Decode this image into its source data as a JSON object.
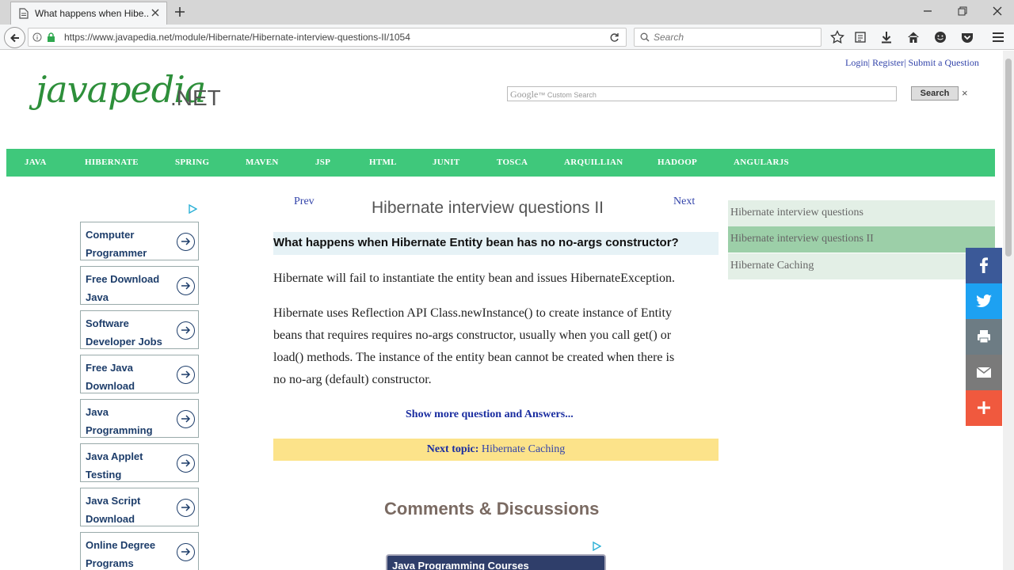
{
  "browser": {
    "tab_title": "What happens when Hibe...",
    "url": "https://www.javapedia.net/module/Hibernate/Hibernate-interview-questions-II/1054",
    "search_placeholder": "Search"
  },
  "header": {
    "top_links": [
      "Login",
      "Register",
      "Submit a Question"
    ],
    "logo_main": "javapedia",
    "logo_suffix": ".NET",
    "google_label_brand": "Google",
    "google_label_text": "Custom Search",
    "search_button": "Search",
    "clear_icon": "×"
  },
  "menu": [
    "JAVA",
    "HIBERNATE",
    "SPRING",
    "MAVEN",
    "JSP",
    "HTML",
    "JUNIT",
    "TOSCA",
    "ARQUILLIAN",
    "HADOOP",
    "ANGULARJS"
  ],
  "left_ads": [
    "Computer Programmer",
    "Free Download Java",
    "Software Developer Jobs",
    "Free Java Download",
    "Java Programming",
    "Java Applet Testing",
    "Java Script Download",
    "Online Degree Programs"
  ],
  "content": {
    "prev": "Prev",
    "next": "Next",
    "title": "Hibernate interview questions II",
    "question": "What happens when Hibernate Entity bean has no no-args constructor?",
    "answer_1": "Hibernate will fail to instantiate the entity bean and issues HibernateException.",
    "answer_2_lines": [
      "Hibernate uses Reflection API Class.newInstance() to create instance of Entity",
      "beans that requires requires no-args constructor, usually when you call get() or",
      "load() methods. The instance of the entity bean cannot be created when there is",
      "no no-arg (default) constructor."
    ],
    "show_more": "Show more question and Answers...",
    "next_topic_label": "Next topic:",
    "next_topic_link": "Hibernate Caching",
    "comments_title": "Comments & Discussions",
    "bottom_ad": "Java Programming Courses"
  },
  "sidebar": {
    "items": [
      "Hibernate interview questions",
      "Hibernate interview questions II",
      "Hibernate Caching"
    ],
    "active_index": 1,
    "colors": {
      "light": "#e3efe6",
      "active": "#9ccfa8"
    }
  },
  "share": [
    {
      "name": "facebook",
      "color": "#3b5998"
    },
    {
      "name": "twitter",
      "color": "#1da1f2"
    },
    {
      "name": "print",
      "color": "#6d7c84"
    },
    {
      "name": "email",
      "color": "#7a7a7a"
    },
    {
      "name": "more",
      "color": "#f0593e"
    }
  ],
  "colors": {
    "menu_bg": "#3fc87b",
    "question_bg": "#e6f2f6",
    "next_topic_bg": "#fce38a"
  }
}
